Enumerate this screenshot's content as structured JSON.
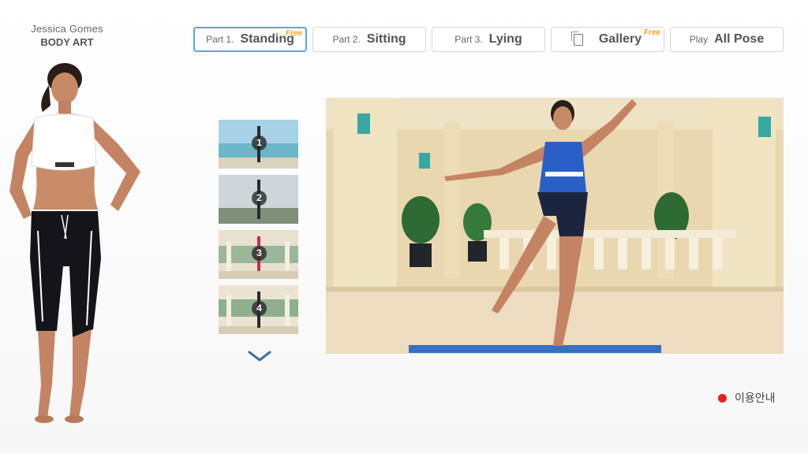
{
  "brand": {
    "name": "Jessica Gomes",
    "title": "BODY ART"
  },
  "tabs": [
    {
      "prefix": "Part 1.",
      "label": "Standing",
      "badge": "Free",
      "active": true
    },
    {
      "prefix": "Part 2.",
      "label": "Sitting",
      "badge": "",
      "active": false
    },
    {
      "prefix": "Part 3.",
      "label": "Lying",
      "badge": "",
      "active": false
    },
    {
      "prefix": "",
      "label": "Gallery",
      "badge": "Free",
      "icon": "gallery-icon",
      "active": false
    },
    {
      "prefix": "Play",
      "label": "All Pose",
      "badge": "",
      "active": false
    }
  ],
  "thumbnails": [
    {
      "number": "1",
      "scene": "beach"
    },
    {
      "number": "2",
      "scene": "hilltop"
    },
    {
      "number": "3",
      "scene": "courtyard"
    },
    {
      "number": "4",
      "scene": "courtyard"
    }
  ],
  "scroll": {
    "icon": "chevron-down-icon"
  },
  "guide": {
    "label": "이용안내",
    "dot_color": "#e8201b"
  },
  "accent": {
    "active_border": "#55a9d6",
    "free_badge": "#f3a020"
  }
}
